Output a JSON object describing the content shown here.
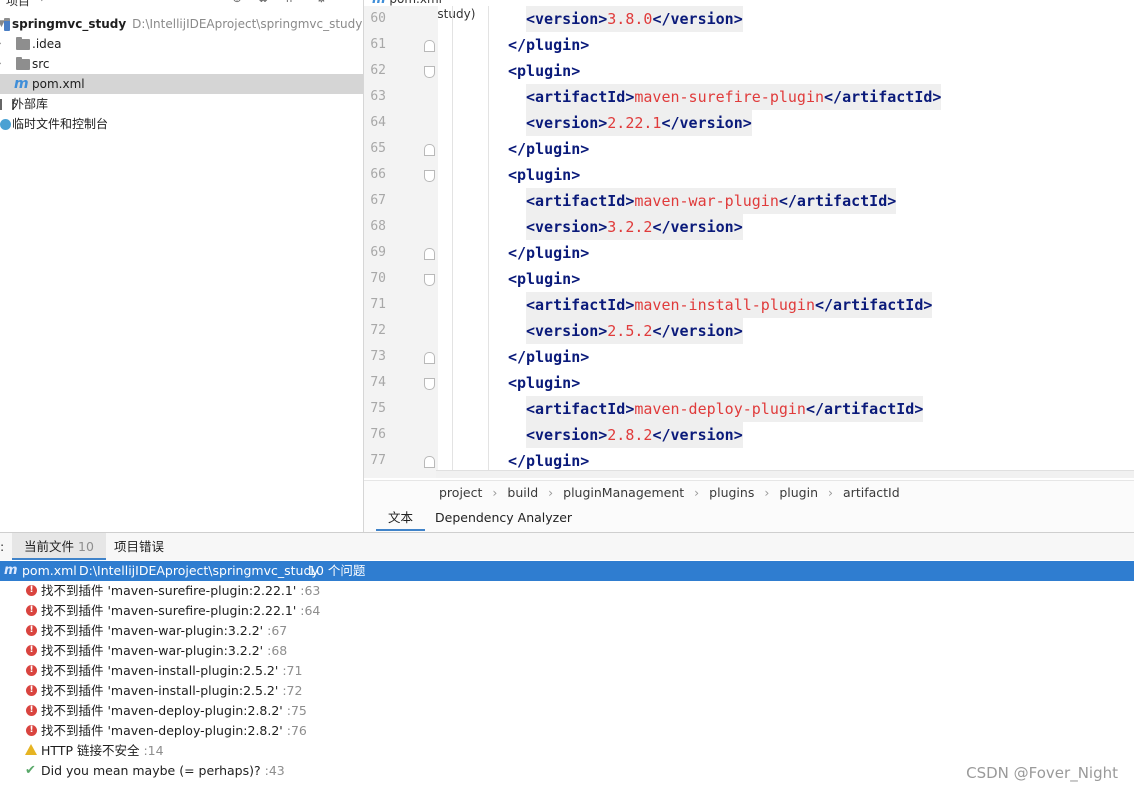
{
  "project_panel": {
    "toolbar_label": "项目",
    "tree": [
      {
        "label": "springmvc_study",
        "path": "D:\\IntellijIDEAproject\\springmvc_study",
        "kind": "module"
      },
      {
        "label": ".idea",
        "kind": "folder"
      },
      {
        "label": "src",
        "kind": "folder"
      },
      {
        "label": "pom.xml",
        "kind": "maven-file"
      },
      {
        "label": "外部库",
        "kind": "library"
      },
      {
        "label": "临时文件和控制台",
        "kind": "scratch"
      }
    ]
  },
  "editor": {
    "tab_label": "pom.xml (springmvc_study)",
    "lines": [
      {
        "num": "60",
        "open": "<version>",
        "value": "3.8.0",
        "close": "</version>"
      },
      {
        "num": "61",
        "open": "</plugin>",
        "value": "",
        "close": ""
      },
      {
        "num": "62",
        "open": "<plugin>",
        "value": "",
        "close": ""
      },
      {
        "num": "63",
        "open": "<artifactId>",
        "value": "maven-surefire-plugin",
        "close": "</artifactId>"
      },
      {
        "num": "64",
        "open": "<version>",
        "value": "2.22.1",
        "close": "</version>"
      },
      {
        "num": "65",
        "open": "</plugin>",
        "value": "",
        "close": ""
      },
      {
        "num": "66",
        "open": "<plugin>",
        "value": "",
        "close": ""
      },
      {
        "num": "67",
        "open": "<artifactId>",
        "value": "maven-war-plugin",
        "close": "</artifactId>"
      },
      {
        "num": "68",
        "open": "<version>",
        "value": "3.2.2",
        "close": "</version>"
      },
      {
        "num": "69",
        "open": "</plugin>",
        "value": "",
        "close": ""
      },
      {
        "num": "70",
        "open": "<plugin>",
        "value": "",
        "close": ""
      },
      {
        "num": "71",
        "open": "<artifactId>",
        "value": "maven-install-plugin",
        "close": "</artifactId>"
      },
      {
        "num": "72",
        "open": "<version>",
        "value": "2.5.2",
        "close": "</version>"
      },
      {
        "num": "73",
        "open": "</plugin>",
        "value": "",
        "close": ""
      },
      {
        "num": "74",
        "open": "<plugin>",
        "value": "",
        "close": ""
      },
      {
        "num": "75",
        "open": "<artifactId>",
        "value": "maven-deploy-plugin",
        "close": "</artifactId>"
      },
      {
        "num": "76",
        "open": "<version>",
        "value": "2.8.2",
        "close": "</version>"
      },
      {
        "num": "77",
        "open": "</plugin>",
        "value": "",
        "close": ""
      }
    ],
    "breadcrumb": [
      "project",
      "build",
      "pluginManagement",
      "plugins",
      "plugin",
      "artifactId"
    ],
    "bottom_tabs": [
      "文本",
      "Dependency Analyzer"
    ]
  },
  "problems": {
    "tabs": [
      {
        "label": "当前文件",
        "count": "10"
      },
      {
        "label": "项目错误",
        "count": ""
      }
    ],
    "file": {
      "name": "pom.xml",
      "path": "D:\\IntellijIDEAproject\\springmvc_study",
      "summary": "10 个问题"
    },
    "items": [
      {
        "severity": "error",
        "text": "找不到插件 'maven-surefire-plugin:2.22.1'",
        "line": ":63"
      },
      {
        "severity": "error",
        "text": "找不到插件 'maven-surefire-plugin:2.22.1'",
        "line": ":64"
      },
      {
        "severity": "error",
        "text": "找不到插件 'maven-war-plugin:3.2.2'",
        "line": ":67"
      },
      {
        "severity": "error",
        "text": "找不到插件 'maven-war-plugin:3.2.2'",
        "line": ":68"
      },
      {
        "severity": "error",
        "text": "找不到插件 'maven-install-plugin:2.5.2'",
        "line": ":71"
      },
      {
        "severity": "error",
        "text": "找不到插件 'maven-install-plugin:2.5.2'",
        "line": ":72"
      },
      {
        "severity": "error",
        "text": "找不到插件 'maven-deploy-plugin:2.8.2'",
        "line": ":75"
      },
      {
        "severity": "error",
        "text": "找不到插件 'maven-deploy-plugin:2.8.2'",
        "line": ":76"
      },
      {
        "severity": "warning",
        "text": "HTTP 链接不安全",
        "line": ":14"
      },
      {
        "severity": "typo",
        "text": "Did you mean maybe (= perhaps)?",
        "line": ":43"
      }
    ]
  },
  "watermark": "CSDN @Fover_Night",
  "colors": {
    "accent": "#2f7dd0",
    "xml_tag": "#0a1a7a",
    "xml_value": "#e03b3b",
    "error": "#d9443f",
    "warning": "#e6b422"
  }
}
